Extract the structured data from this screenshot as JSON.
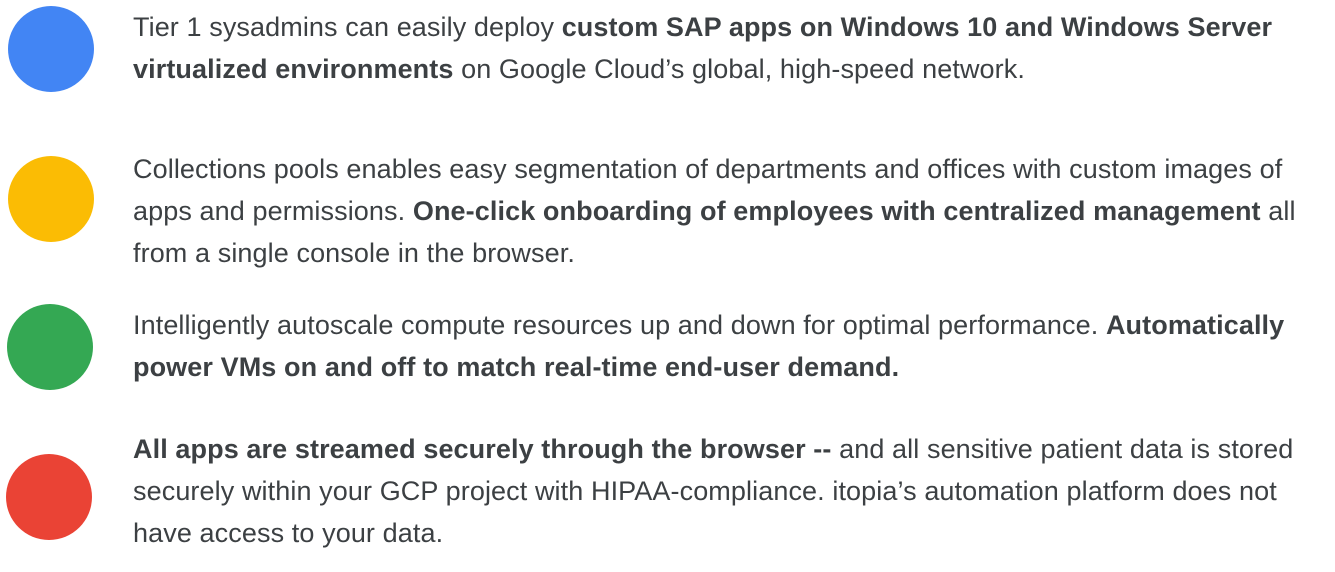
{
  "colors": {
    "blue": "#4285f4",
    "yellow": "#fbbc04",
    "green": "#34a853",
    "red": "#ea4335",
    "text": "#3c4043"
  },
  "features": [
    {
      "icon": "blue-circle-icon",
      "color": "#4285f4",
      "parts": [
        {
          "text": "Tier 1 sysadmins can easily deploy ",
          "bold": false
        },
        {
          "text": "custom SAP apps on Windows 10 and Windows Server virtualized environments",
          "bold": true
        },
        {
          "text": " on Google Cloud’s global, high-speed network.",
          "bold": false
        }
      ]
    },
    {
      "icon": "yellow-circle-icon",
      "color": "#fbbc04",
      "parts": [
        {
          "text": "Collections pools enables easy segmentation of departments and offices with custom images of apps and permissions. ",
          "bold": false
        },
        {
          "text": "One-click onboarding of employees with centralized management",
          "bold": true
        },
        {
          "text": " all from a single console in the browser.",
          "bold": false
        }
      ]
    },
    {
      "icon": "green-circle-icon",
      "color": "#34a853",
      "parts": [
        {
          "text": "Intelligently autoscale compute resources up and down for optimal performance. ",
          "bold": false
        },
        {
          "text": "Automatically power VMs on and off to match real-time end-user demand.",
          "bold": true
        }
      ]
    },
    {
      "icon": "red-circle-icon",
      "color": "#ea4335",
      "parts": [
        {
          "text": "All apps are streamed securely through the browser --",
          "bold": true
        },
        {
          "text": " and all sensitive patient data is stored securely within your GCP project with HIPAA-compliance. itopia’s automation platform does not have access to your data.",
          "bold": false
        }
      ]
    }
  ]
}
